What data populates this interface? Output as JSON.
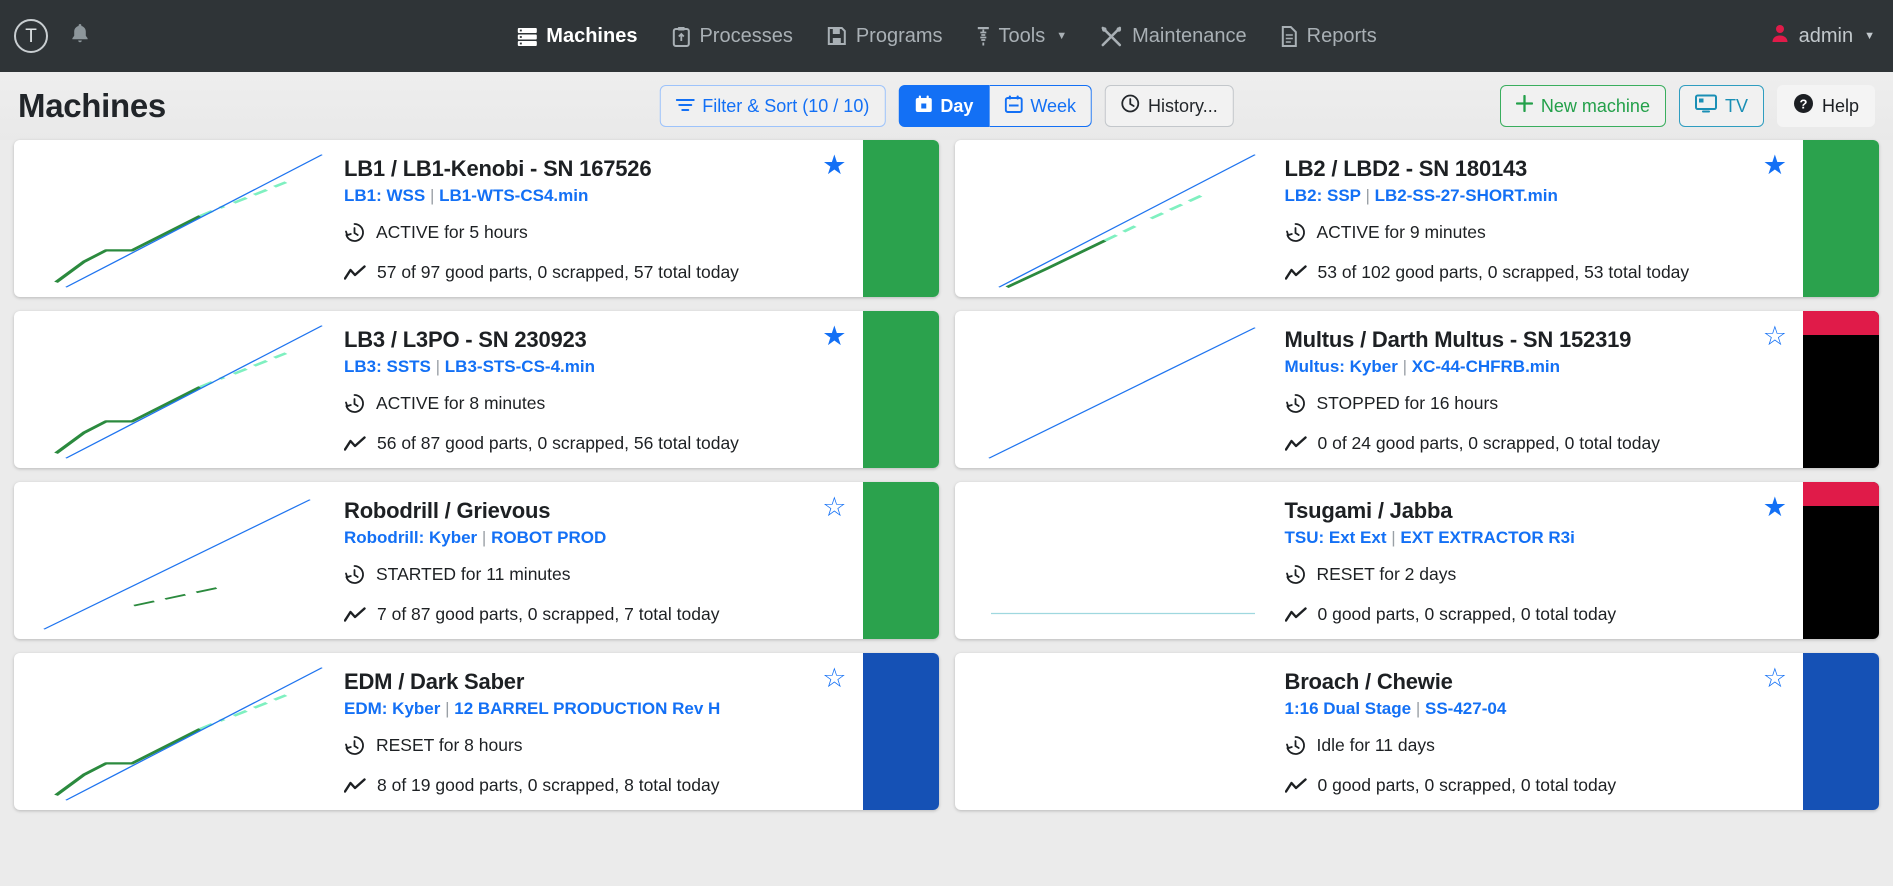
{
  "nav": {
    "logo_letter": "T",
    "bell_icon": "bell-icon",
    "items": [
      {
        "label": "Machines",
        "icon": "machines-icon",
        "active": true,
        "caret": false
      },
      {
        "label": "Processes",
        "icon": "processes-icon",
        "active": false,
        "caret": false
      },
      {
        "label": "Programs",
        "icon": "programs-icon",
        "active": false,
        "caret": false
      },
      {
        "label": "Tools",
        "icon": "tools-icon",
        "active": false,
        "caret": true
      },
      {
        "label": "Maintenance",
        "icon": "maintenance-icon",
        "active": false,
        "caret": false
      },
      {
        "label": "Reports",
        "icon": "reports-icon",
        "active": false,
        "caret": false
      }
    ],
    "user": {
      "label": "admin",
      "icon": "user-icon",
      "caret": "▾"
    }
  },
  "header": {
    "title": "Machines",
    "filter_sort": "Filter & Sort (10 / 10)",
    "day": "Day",
    "week": "Week",
    "history": "History...",
    "new_machine": "New machine",
    "tv": "TV",
    "help": "Help"
  },
  "colors": {
    "accent_blue": "#1370f5",
    "green": "#2ba24d",
    "red": "#e01b49",
    "black": "#000000",
    "nav_bg": "#2f3437"
  },
  "cards": [
    {
      "title": "LB1 / LB1-Kenobi - SN 167526",
      "sub_left": "LB1: WSS",
      "sub_right": "LB1-WTS-CS4.min",
      "status": "ACTIVE for 5 hours",
      "parts": "57 of 97 good parts, 0 scrapped, 57 total today",
      "starred": true,
      "status_color": "#2ba24d",
      "status_top_color": null,
      "spark": "full"
    },
    {
      "title": "LB2 / LBD2 - SN 180143",
      "sub_left": "LB2: SSP",
      "sub_right": "LB2-SS-27-SHORT.min",
      "status": "ACTIVE for 9 minutes",
      "parts": "53 of 102 good parts, 0 scrapped, 53 total today",
      "starred": true,
      "status_color": "#2ba24d",
      "status_top_color": null,
      "spark": "short"
    },
    {
      "title": "LB3 / L3PO - SN 230923",
      "sub_left": "LB3: SSTS",
      "sub_right": "LB3-STS-CS-4.min",
      "status": "ACTIVE for 8 minutes",
      "parts": "56 of 87 good parts, 0 scrapped, 56 total today",
      "starred": true,
      "status_color": "#2ba24d",
      "status_top_color": null,
      "spark": "full"
    },
    {
      "title": "Multus / Darth Multus - SN 152319",
      "sub_left": "Multus: Kyber",
      "sub_right": "XC-44-CHFRB.min",
      "status": "STOPPED for 16 hours",
      "parts": "0 of 24 good parts, 0 scrapped, 0 total today",
      "starred": false,
      "status_color": "#000000",
      "status_top_color": "#e01b49",
      "spark": "line-only"
    },
    {
      "title": "Robodrill / Grievous",
      "sub_left": "Robodrill: Kyber",
      "sub_right": "ROBOT PROD",
      "status": "STARTED for 11 minutes",
      "parts": "7 of 87 good parts, 0 scrapped, 7 total today",
      "starred": false,
      "status_color": "#2ba24d",
      "status_top_color": null,
      "spark": "dashed"
    },
    {
      "title": "Tsugami / Jabba",
      "sub_left": "TSU: Ext Ext",
      "sub_right": "EXT EXTRACTOR R3i",
      "status": "RESET for 2 days",
      "parts": "0 good parts, 0 scrapped, 0 total today",
      "starred": true,
      "status_color": "#000000",
      "status_top_color": "#e01b49",
      "spark": "flat"
    },
    {
      "title": "EDM / Dark Saber",
      "sub_left": "EDM: Kyber",
      "sub_right": "12 BARREL PRODUCTION Rev H",
      "status": "RESET for 8 hours",
      "parts": "8 of 19 good parts, 0 scrapped, 8 total today",
      "starred": false,
      "status_color": "#1551b5",
      "status_top_color": null,
      "spark": "full"
    },
    {
      "title": "Broach / Chewie",
      "sub_left": "1:16 Dual Stage",
      "sub_right": "SS-427-04",
      "status": "Idle for 11 days",
      "parts": "0 good parts, 0 scrapped, 0 total today",
      "starred": false,
      "status_color": "#1551b5",
      "status_top_color": null,
      "spark": "none"
    }
  ]
}
